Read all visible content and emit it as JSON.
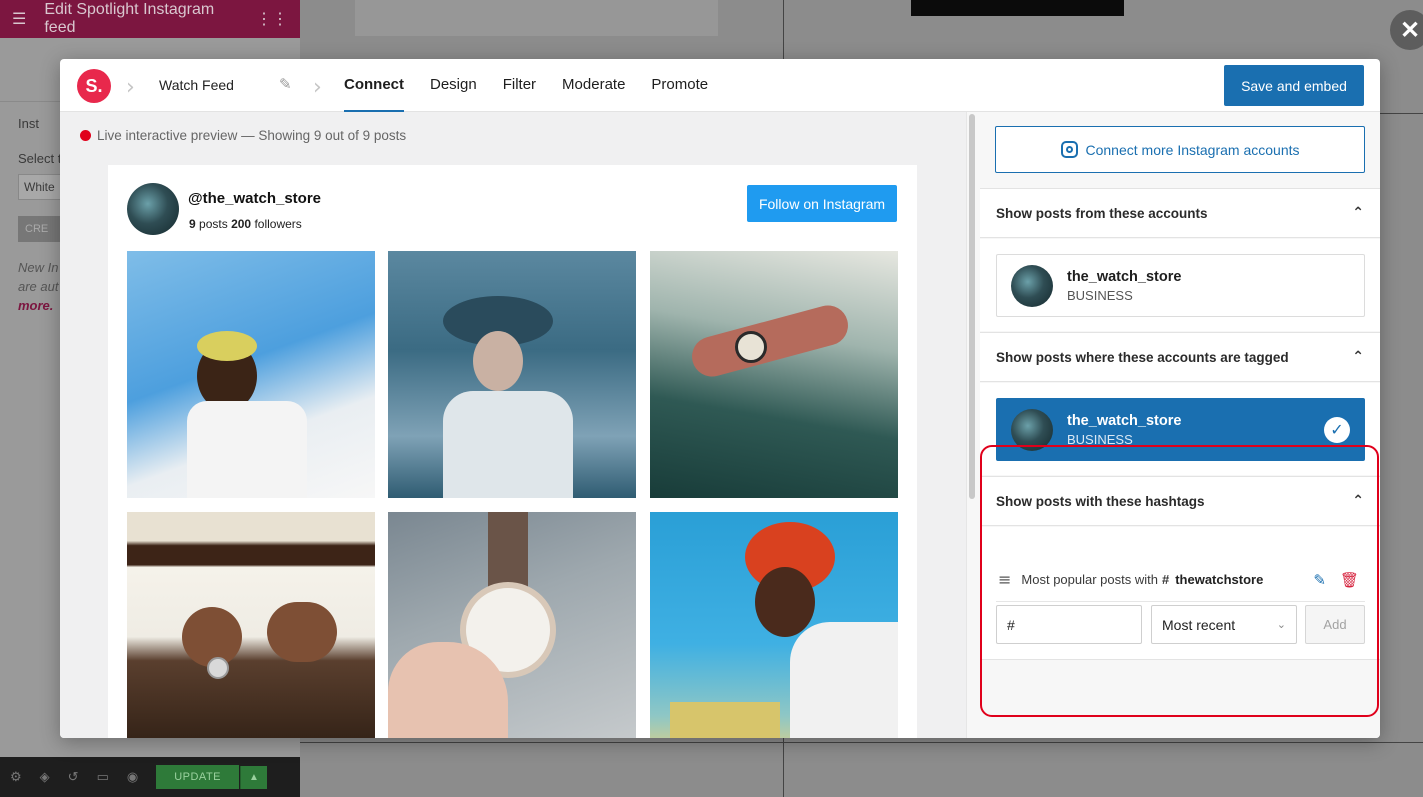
{
  "editor": {
    "title": "Edit Spotlight Instagram feed",
    "section_label": "Inst",
    "select_label": "Select t",
    "select_value": "White",
    "create_label": "CRE",
    "note_lines": [
      "New In",
      "are aut",
      "more."
    ],
    "update_label": "UPDATE"
  },
  "modal": {
    "logo": "S.",
    "feed_name": "Watch Feed",
    "tabs": [
      {
        "label": "Connect",
        "active": true
      },
      {
        "label": "Design",
        "active": false
      },
      {
        "label": "Filter",
        "active": false
      },
      {
        "label": "Moderate",
        "active": false
      },
      {
        "label": "Promote",
        "active": false
      }
    ],
    "save_label": "Save and embed",
    "close_icon": "close-icon"
  },
  "preview": {
    "live_text": "Live interactive preview — Showing 9 out of 9 posts",
    "handle": "@the_watch_store",
    "posts_count": "9",
    "posts_label": "posts",
    "followers_count": "200",
    "followers_label": "followers",
    "follow_label": "Follow on Instagram"
  },
  "sidebar": {
    "connect_label": "Connect more Instagram accounts",
    "sections": {
      "from_accounts": "Show posts from these accounts",
      "tagged": "Show posts where these accounts are tagged",
      "hashtags": "Show posts with these hashtags"
    },
    "account": {
      "name": "the_watch_store",
      "type": "BUSINESS"
    },
    "tagged_account": {
      "name": "the_watch_store",
      "type": "BUSINESS",
      "selected": true
    },
    "hashtag_item": {
      "prefix": "Most popular posts with",
      "symbol": "#",
      "tag": "thewatchstore"
    },
    "hashtag_input_value": "#",
    "order_value": "Most recent",
    "add_label": "Add"
  },
  "colors": {
    "accent": "#1a6fb0",
    "instagram_blue": "#1f9bf0",
    "highlight_red": "#e0001b",
    "brand_red": "#e8284c",
    "elementor_maroon": "#7c1640"
  }
}
